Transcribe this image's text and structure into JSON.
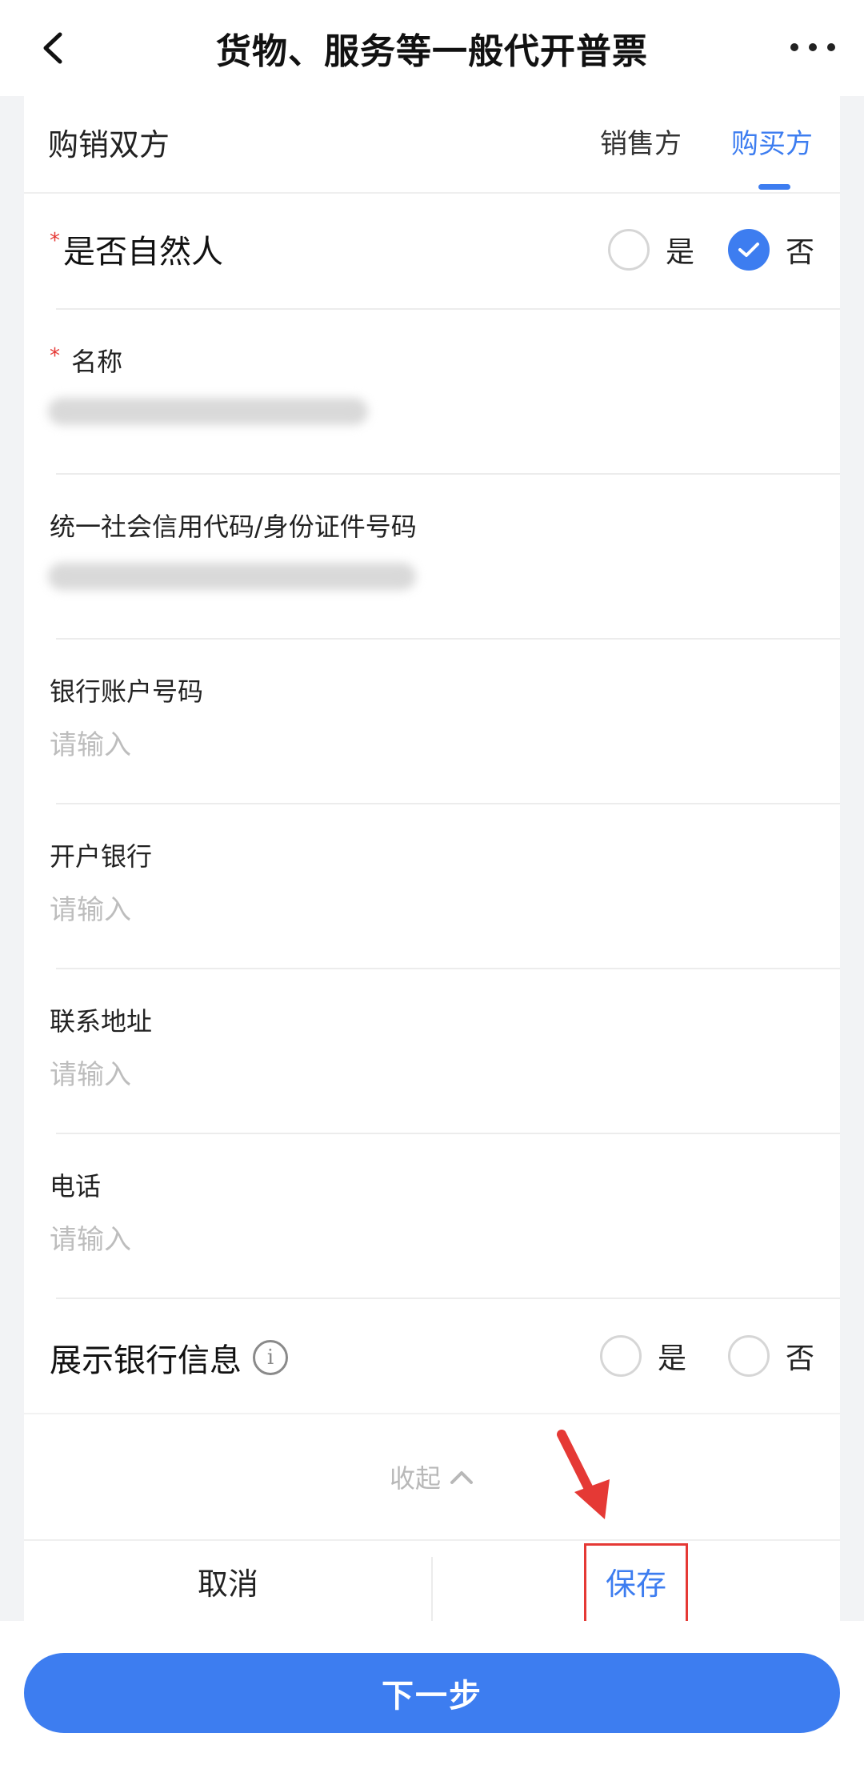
{
  "header": {
    "title": "货物、服务等一般代开普票"
  },
  "section": {
    "title": "购销双方",
    "tabs": [
      {
        "label": "销售方",
        "active": false
      },
      {
        "label": "购买方",
        "active": true
      }
    ]
  },
  "natural_person": {
    "label": "是否自然人",
    "required_mark": "*",
    "options": [
      {
        "label": "是",
        "selected": false
      },
      {
        "label": "否",
        "selected": true
      }
    ]
  },
  "fields": {
    "name": {
      "label": "名称",
      "required_mark": "*"
    },
    "credit_code": {
      "label": "统一社会信用代码/身份证件号码"
    },
    "bank_account": {
      "label": "银行账户号码",
      "placeholder": "请输入"
    },
    "bank_name": {
      "label": "开户银行",
      "placeholder": "请输入"
    },
    "address": {
      "label": "联系地址",
      "placeholder": "请输入"
    },
    "phone": {
      "label": "电话",
      "placeholder": "请输入"
    }
  },
  "show_bank_info": {
    "label": "展示银行信息",
    "info_glyph": "i",
    "options": [
      {
        "label": "是",
        "selected": false
      },
      {
        "label": "否",
        "selected": false
      }
    ]
  },
  "collapse": {
    "label": "收起"
  },
  "actions": {
    "cancel_label": "取消",
    "save_label": "保存"
  },
  "footer": {
    "next_label": "下一步"
  },
  "colors": {
    "accent": "#3d7df0",
    "required": "#e53935",
    "annotation": "#e53935"
  }
}
